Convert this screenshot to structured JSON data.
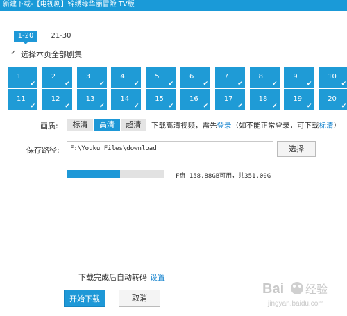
{
  "window": {
    "title": "新建下载-【电视剧】锦绣缘华丽冒险 TV版"
  },
  "range_tabs": [
    {
      "label": "1-20",
      "active": true
    },
    {
      "label": "21-30",
      "active": false
    }
  ],
  "select_all": {
    "label": "选择本页全部剧集",
    "checked": true
  },
  "episodes": [
    "1",
    "2",
    "3",
    "4",
    "5",
    "6",
    "7",
    "8",
    "9",
    "10",
    "11",
    "12",
    "13",
    "14",
    "15",
    "16",
    "17",
    "18",
    "19",
    "20"
  ],
  "quality": {
    "label": "画质:",
    "options": [
      {
        "label": "标清",
        "selected": false
      },
      {
        "label": "高清",
        "selected": true
      },
      {
        "label": "超清",
        "selected": false
      }
    ],
    "note_prefix": "下载高清视频，需先",
    "login_link": "登录",
    "note_middle": "（如不能正常登录，可下载",
    "sd_link": "标清",
    "note_suffix": "）"
  },
  "save_path": {
    "label": "保存路径:",
    "value": "F:\\Youku Files\\download",
    "choose_button": "选择"
  },
  "disk": {
    "used_fraction": 0.55,
    "info": "F盘 158.88GB可用，共351.00G"
  },
  "auto_convert": {
    "label": "下载完成后自动转码",
    "checked": false,
    "settings_link": "设置"
  },
  "buttons": {
    "start": "开始下载",
    "cancel": "取消"
  },
  "watermark": {
    "text": "Baidu经验",
    "url": "jingyan.baidu.com"
  },
  "colors": {
    "accent": "#1e98d7",
    "link": "#1e88d0"
  }
}
